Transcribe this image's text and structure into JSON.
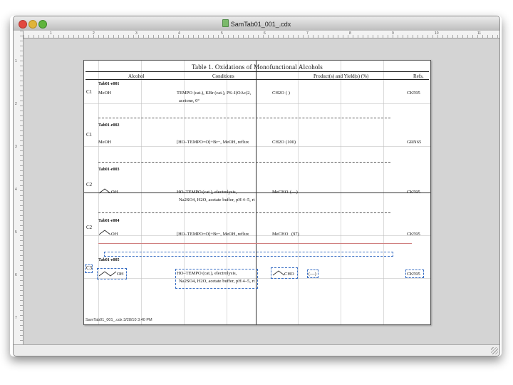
{
  "window": {
    "title": "SamTab01_001_.cdx"
  },
  "rulers": {
    "h_labels": [
      "1",
      "2",
      "3",
      "4",
      "5",
      "6",
      "7",
      "8",
      "9",
      "10",
      "11"
    ],
    "v_labels": [
      "1",
      "2",
      "3",
      "4",
      "5",
      "6",
      "7",
      "8"
    ]
  },
  "table": {
    "title": "Table 1. Oxidations of Monofunctional Alcohols",
    "headers": {
      "alcohol": "Alcohol",
      "conditions": "Conditions",
      "products": "Product(s) and Yield(s) (%)",
      "refs": "Refs."
    },
    "entries": [
      {
        "id": "Tab01-e001",
        "carbon": "C1",
        "alcohol": "MeOH",
        "conditions": "TEMPO (cat.), KBr (cat.), PS–I(OAc)2,",
        "conditions2": "acetone, 0°",
        "product": "CH2O",
        "yield": "(   )",
        "ref": "CK595"
      },
      {
        "id": "Tab01-e002",
        "carbon": "C1",
        "alcohol": "MeOH",
        "conditions": "[HO–TEMPO=O]+Br−, MeOH, reflux",
        "conditions2": "",
        "product": "CH2O",
        "yield": "(100)",
        "ref": "GRN65"
      },
      {
        "id": "Tab01-e003",
        "carbon": "C2",
        "alcohol": "OH",
        "conditions": "HO–TEMPO (cat.), electrolysis,",
        "conditions2": "Na2SO4, H2O, acetate buffer, pH 4–5, rt",
        "product": "MeCHO",
        "yield": "(—)",
        "ref": "CK595"
      },
      {
        "id": "Tab01-e004",
        "carbon": "C2",
        "alcohol": "OH",
        "conditions": "[HO–TEMPO=O]+Br−, MeOH, reflux",
        "conditions2": "",
        "product": "MeCHO",
        "yield": "(97)",
        "ref": "CK595"
      },
      {
        "id": "Tab01-e005",
        "carbon": "C3",
        "alcohol": "OH",
        "conditions": "HO–TEMPO (cat.), electrolysis,",
        "conditions2": "Na2SO4, H2O, acetate buffer, pH 4–5, rt",
        "product": "CHO",
        "yield": "(—)",
        "ref": "CK595"
      }
    ]
  },
  "footer": "SamTab01_001_.cdx  3/28/10  3:40 PM"
}
